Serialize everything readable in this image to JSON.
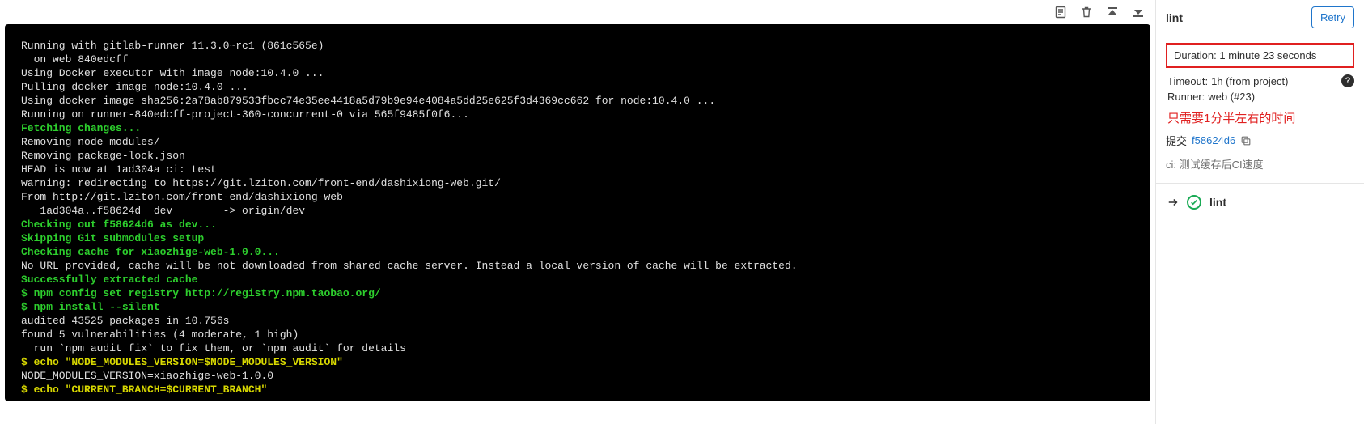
{
  "toolbar": {
    "raw_title": "Show complete raw",
    "erase_title": "Erase job log",
    "scroll_top_title": "Scroll to top",
    "scroll_bottom_title": "Scroll to bottom"
  },
  "log": {
    "lines": [
      {
        "cls": "t-white",
        "text": "Running with gitlab-runner 11.3.0~rc1 (861c565e)"
      },
      {
        "cls": "t-white",
        "text": "  on web 840edcff"
      },
      {
        "cls": "t-white",
        "text": "Using Docker executor with image node:10.4.0 ..."
      },
      {
        "cls": "t-white",
        "text": "Pulling docker image node:10.4.0 ..."
      },
      {
        "cls": "t-white",
        "text": "Using docker image sha256:2a78ab879533fbcc74e35ee4418a5d79b9e94e4084a5dd25e625f3d4369cc662 for node:10.4.0 ..."
      },
      {
        "cls": "t-white",
        "text": "Running on runner-840edcff-project-360-concurrent-0 via 565f9485f0f6..."
      },
      {
        "cls": "t-green-b",
        "text": "Fetching changes..."
      },
      {
        "cls": "t-white",
        "text": "Removing node_modules/"
      },
      {
        "cls": "t-white",
        "text": "Removing package-lock.json"
      },
      {
        "cls": "t-white",
        "text": "HEAD is now at 1ad304a ci: test"
      },
      {
        "cls": "t-white",
        "text": "warning: redirecting to https://git.lziton.com/front-end/dashixiong-web.git/"
      },
      {
        "cls": "t-white",
        "text": "From http://git.lziton.com/front-end/dashixiong-web"
      },
      {
        "cls": "t-white",
        "text": "   1ad304a..f58624d  dev        -> origin/dev"
      },
      {
        "cls": "t-green-b",
        "text": "Checking out f58624d6 as dev..."
      },
      {
        "cls": "t-green-b",
        "text": "Skipping Git submodules setup"
      },
      {
        "cls": "t-green-b",
        "text": "Checking cache for xiaozhige-web-1.0.0..."
      },
      {
        "cls": "t-white",
        "text": "No URL provided, cache will be not downloaded from shared cache server. Instead a local version of cache will be extracted."
      },
      {
        "cls": "t-green-b",
        "text": "Successfully extracted cache"
      },
      {
        "cls": "t-green-b",
        "text": "$ npm config set registry http://registry.npm.taobao.org/"
      },
      {
        "cls": "t-green-b",
        "text": "$ npm install --silent"
      },
      {
        "cls": "t-white",
        "text": "audited 43525 packages in 10.756s"
      },
      {
        "cls": "t-white",
        "text": "found 5 vulnerabilities (4 moderate, 1 high)"
      },
      {
        "cls": "t-white",
        "text": "  run `npm audit fix` to fix them, or `npm audit` for details"
      },
      {
        "cls": "t-yellow-b",
        "text": "$ echo \"NODE_MODULES_VERSION=$NODE_MODULES_VERSION\""
      },
      {
        "cls": "t-white",
        "text": "NODE_MODULES_VERSION=xiaozhige-web-1.0.0"
      },
      {
        "cls": "t-yellow-b",
        "text": "$ echo \"CURRENT_BRANCH=$CURRENT_BRANCH\""
      }
    ]
  },
  "sidebar": {
    "title": "lint",
    "retry_label": "Retry",
    "duration_label": "Duration:",
    "duration_value": "1 minute 23 seconds",
    "timeout_label": "Timeout:",
    "timeout_value": "1h (from project)",
    "runner_label": "Runner:",
    "runner_value": "web (#23)",
    "annotation": "只需要1分半左右的时间",
    "commit_label": "提交",
    "commit_sha": "f58624d6",
    "commit_message": "ci: 测试缓存后CI速度",
    "stage_name": "lint"
  }
}
